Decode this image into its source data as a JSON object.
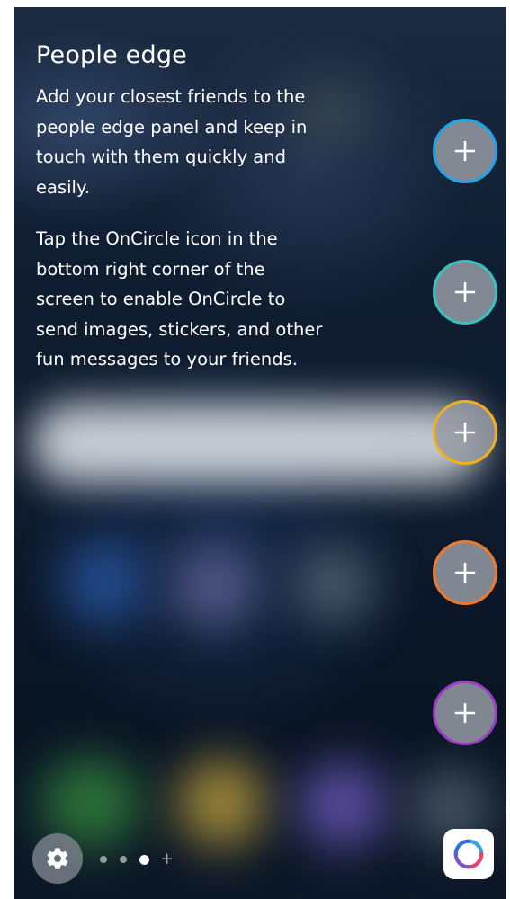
{
  "panel": {
    "title": "People edge",
    "description": "Add your closest friends to the people edge panel and keep in touch with them quickly and easily.",
    "oncircle_hint": "Tap the OnCircle icon in the bottom right corner of the screen to enable OnCircle to send images, stickers, and other fun messages to your friends."
  },
  "contact_slots": [
    {
      "icon": "plus-icon",
      "ring_color": "#1ea4e8"
    },
    {
      "icon": "plus-icon",
      "ring_color": "#36c2c0"
    },
    {
      "icon": "plus-icon",
      "ring_color": "#f2b01e"
    },
    {
      "icon": "plus-icon",
      "ring_color": "#f07a2c"
    },
    {
      "icon": "plus-icon",
      "ring_color": "#9b3fc2"
    }
  ],
  "footer": {
    "settings_icon": "gear-icon",
    "page_indicator": {
      "pages": 3,
      "current_page": 3,
      "add_page_label": "+"
    },
    "oncircle_icon": "oncircle-icon"
  }
}
